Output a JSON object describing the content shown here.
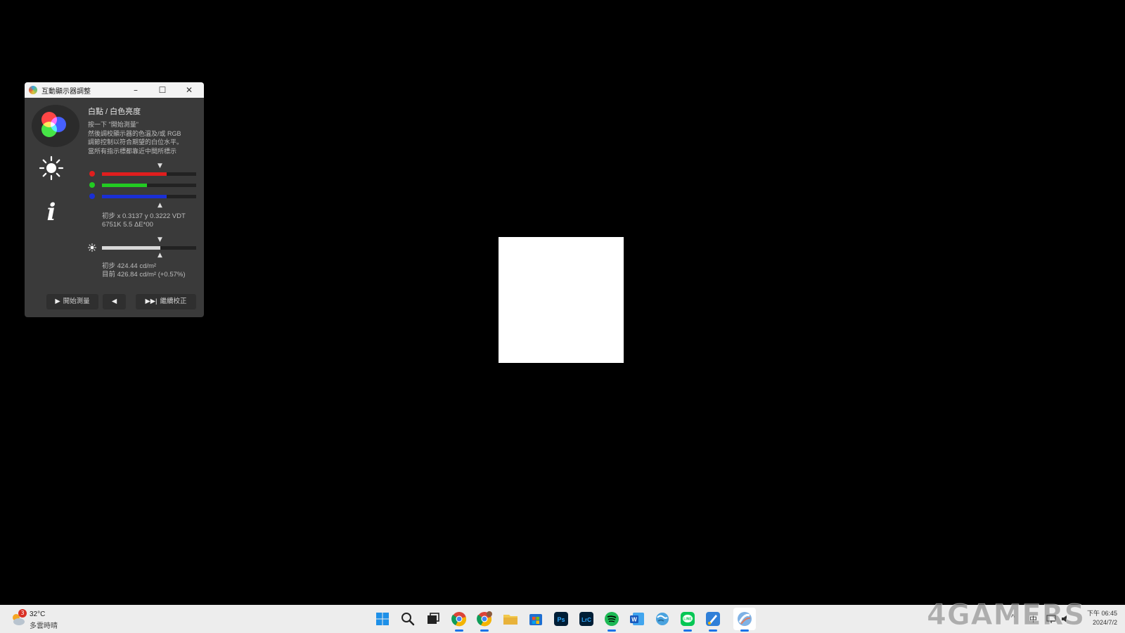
{
  "window": {
    "title": "互動顯示器調整",
    "controls": {
      "minimize": "–",
      "maximize": "☐",
      "close": "✕"
    },
    "icons": [
      "rgb-color-icon",
      "brightness-sun-icon",
      "info-icon"
    ],
    "heading": "白點 / 白色亮度",
    "instructions": [
      "按一下 \"開始測量\"",
      "然後調校顯示器的色溫及/或 RGB",
      "調節控制以符合期望的白位水平。",
      "當所有指示標都靠近中間所標示"
    ],
    "channels": [
      {
        "name": "red",
        "color": "#e01e1e",
        "level": 0.69
      },
      {
        "name": "green",
        "color": "#22cc22",
        "level": 0.48
      },
      {
        "name": "blue",
        "color": "#1a2fd6",
        "level": 0.69
      }
    ],
    "marker_down": "▼",
    "marker_up": "▲",
    "color_readout": {
      "line1": "初步 x 0.3137 y 0.3222 VDT",
      "line2": "6751K 5.5 ΔE*00"
    },
    "brightness": {
      "level": 0.62,
      "color": "#d8d8d8"
    },
    "brightness_readout": {
      "line1": "初步 424.44 cd/m²",
      "line2": "目前 426.84 cd/m² (+0.57%)"
    },
    "buttons": {
      "start_icon": "▶",
      "start": "開始測量",
      "back_icon": "◀",
      "continue_icon": "▶▶|",
      "continue": "繼續校正"
    }
  },
  "desktop": {
    "patch_color": "#ffffff",
    "background": "#000000"
  },
  "taskbar": {
    "weather": {
      "badge": "3",
      "temp": "32°C",
      "condition": "多雲時晴"
    },
    "apps": [
      "start-icon",
      "search-icon",
      "task-view-icon",
      "chrome-icon",
      "chrome-profile-icon",
      "file-explorer-icon",
      "microsoft-store-icon",
      "photoshop-icon",
      "lightroom-classic-icon",
      "spotify-icon",
      "word-icon",
      "network-icon",
      "line-icon",
      "paint-icon",
      "displaycal-icon"
    ],
    "tray": {
      "chevron": "^",
      "ime": "中"
    },
    "clock": {
      "time": "下午 06:45",
      "date": "2024/7/2"
    }
  },
  "watermark": "4GAMERS"
}
